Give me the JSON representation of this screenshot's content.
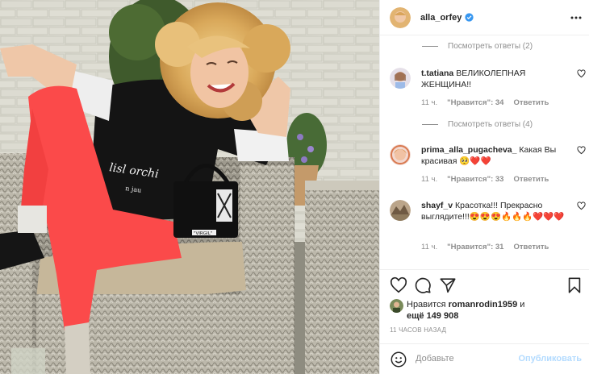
{
  "post": {
    "author": "alla_orfey",
    "verified": true
  },
  "comments": {
    "view_replies_1": "Посмотреть ответы (2)",
    "view_replies_2": "Посмотреть ответы (4)",
    "items": [
      {
        "username": "t.tatiana",
        "text": "ВЕЛИКОЛЕПНАЯ ЖЕНЩИНА!!",
        "time": "11 ч.",
        "likes": "\"Нравится\": 34",
        "reply": "Ответить"
      },
      {
        "username": "prima_alla_pugacheva_",
        "text": "Какая Вы красивая 🥺❤️❤️",
        "time": "11 ч.",
        "likes": "\"Нравится\": 33",
        "reply": "Ответить"
      },
      {
        "username": "shayf_v",
        "text": "Красотка!!! Прекрасно выглядите!!!😍😍😍🔥🔥🔥❤️❤️❤️",
        "time": "11 ч.",
        "likes": "\"Нравится\": 31",
        "reply": "Ответить"
      }
    ]
  },
  "likes": {
    "prefix": "Нравится",
    "user": "romanrodin1959",
    "and": "и",
    "others": "ещё 149 908"
  },
  "timestamp": "11 ЧАСОВ НАЗАД",
  "add_comment": {
    "placeholder": "Добавьте",
    "publish": "Опубликовать"
  },
  "icons": {
    "like": "heart-icon",
    "comment": "comment-icon",
    "share": "paper-plane-icon",
    "save": "bookmark-icon",
    "more": "more-icon",
    "emoji": "smiley-icon",
    "verified": "verified-badge-icon"
  },
  "colors": {
    "verified": "#3897f0",
    "publish_disabled": "#b3dbff",
    "secondary_text": "#8e8e8e"
  }
}
